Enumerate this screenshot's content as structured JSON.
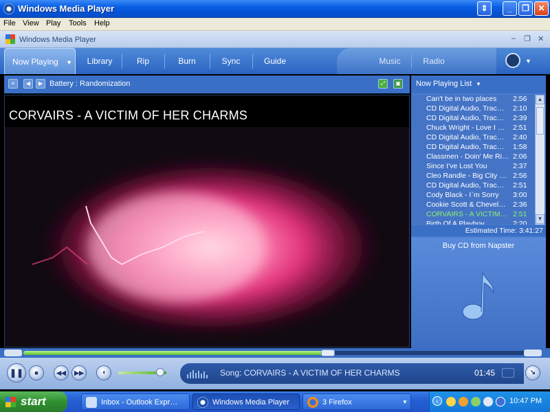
{
  "window": {
    "title": "Windows Media Player"
  },
  "menu": [
    "File",
    "View",
    "Play",
    "Tools",
    "Help"
  ],
  "skin_header": {
    "title": "Windows Media Player"
  },
  "nav": {
    "now_playing": "Now Playing",
    "tabs": [
      "Library",
      "Rip",
      "Burn",
      "Sync",
      "Guide"
    ],
    "right_tabs": [
      "Music",
      "Radio"
    ]
  },
  "subbar": {
    "visualization": "Battery : Randomization"
  },
  "video": {
    "title": "CORVAIRS - A VICTIM OF HER CHARMS"
  },
  "playlist": {
    "header": "Now Playing List",
    "items": [
      {
        "title": "Can't be in two places",
        "duration": "2:56"
      },
      {
        "title": "CD Digital Audio, Trac…",
        "duration": "2:10"
      },
      {
        "title": "CD Digital Audio, Trac…",
        "duration": "2:39"
      },
      {
        "title": "Chuck Wright - Love I …",
        "duration": "2:51"
      },
      {
        "title": "CD Digital Audio, Trac…",
        "duration": "2:40"
      },
      {
        "title": "CD Digital Audio, Trac…",
        "duration": "1:58"
      },
      {
        "title": "Classmen - Doin' Me Ri…",
        "duration": "2:06"
      },
      {
        "title": "Since I've Lost You",
        "duration": "2:37"
      },
      {
        "title": "Cleo Randle - Big City …",
        "duration": "2:56"
      },
      {
        "title": "CD Digital Audio, Trac…",
        "duration": "2:51"
      },
      {
        "title": "Cody Black - I`m Sorry",
        "duration": "3:00"
      },
      {
        "title": "Cookie Scott & Chevel…",
        "duration": "2:36"
      },
      {
        "title": "CORVAIRS - A VICTIM…",
        "duration": "2:51"
      },
      {
        "title": "Birth Of A Playboy",
        "duration": "2:20"
      }
    ],
    "current_index": 12,
    "estimated_time": "Estimated Time: 3:41:27",
    "buy_cd": "Buy CD from Napster"
  },
  "player": {
    "song": "Song: CORVAIRS - A VICTIM OF HER CHARMS",
    "time": "01:45",
    "seek_progress": 0.6,
    "volume": 0.87
  },
  "taskbar": {
    "start": "start",
    "tasks": [
      "Inbox - Outlook Expr…",
      "Windows Media Player",
      "3 Firefox"
    ],
    "clock": "10:47 PM"
  },
  "colors": {
    "accent": "#3a6fc6",
    "current_track": "#8ef06e",
    "seek_fill": "#5cbf30"
  },
  "icons": [
    "media-player-icon",
    "napster-icon",
    "music-note-icon",
    "outlook-icon",
    "firefox-icon",
    "shield-icon",
    "speaker-icon",
    "wifi-icon"
  ]
}
